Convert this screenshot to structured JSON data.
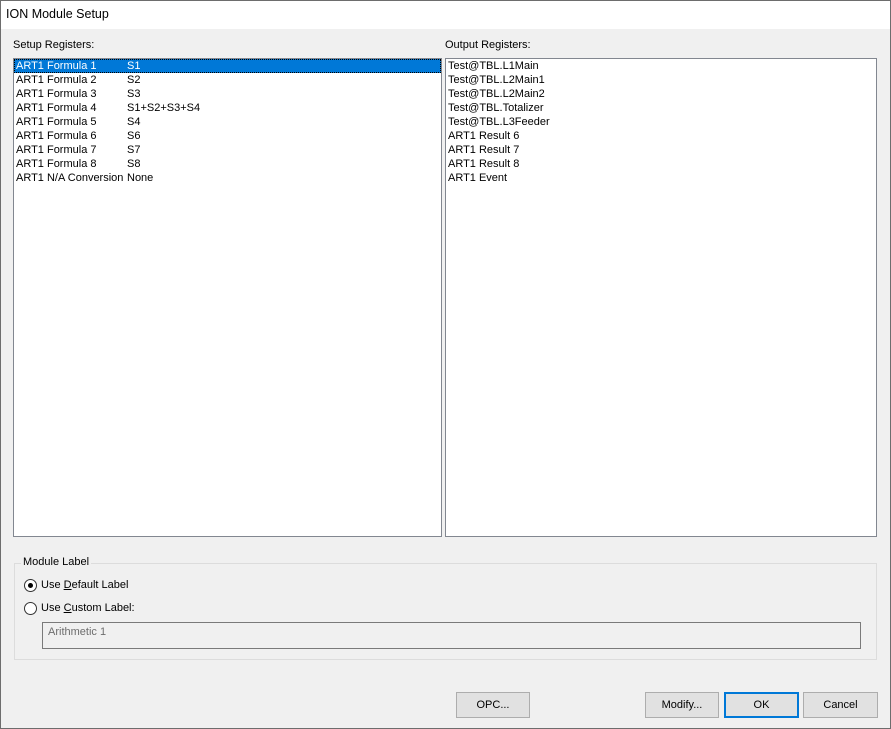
{
  "window": {
    "title": "ION Module Setup"
  },
  "setup_registers": {
    "label": "Setup Registers:",
    "rows": [
      {
        "name": "ART1 Formula 1",
        "value": "S1",
        "selected": true
      },
      {
        "name": "ART1 Formula 2",
        "value": "S2",
        "selected": false
      },
      {
        "name": "ART1 Formula 3",
        "value": "S3",
        "selected": false
      },
      {
        "name": "ART1 Formula 4",
        "value": "S1+S2+S3+S4",
        "selected": false
      },
      {
        "name": "ART1 Formula 5",
        "value": "S4",
        "selected": false
      },
      {
        "name": "ART1 Formula 6",
        "value": "S6",
        "selected": false
      },
      {
        "name": "ART1 Formula 7",
        "value": "S7",
        "selected": false
      },
      {
        "name": "ART1 Formula 8",
        "value": "S8",
        "selected": false
      },
      {
        "name": "ART1 N/A Conversion",
        "value": "None",
        "selected": false
      }
    ]
  },
  "output_registers": {
    "label": "Output Registers:",
    "rows": [
      "Test@TBL.L1Main",
      "Test@TBL.L2Main1",
      "Test@TBL.L2Main2",
      "Test@TBL.Totalizer",
      "Test@TBL.L3Feeder",
      "ART1 Result 6",
      "ART1 Result 7",
      "ART1 Result 8",
      "ART1 Event"
    ]
  },
  "module_label": {
    "legend": "Module Label",
    "default_option": {
      "prefix": "Use ",
      "mnemonic": "D",
      "suffix": "efault Label",
      "checked": true
    },
    "custom_option": {
      "prefix": "Use ",
      "mnemonic": "C",
      "suffix": "ustom Label:",
      "checked": false
    },
    "custom_value": "Arithmetic 1"
  },
  "buttons": {
    "opc": "OPC...",
    "modify": "Modify...",
    "ok": "OK",
    "cancel": "Cancel"
  }
}
